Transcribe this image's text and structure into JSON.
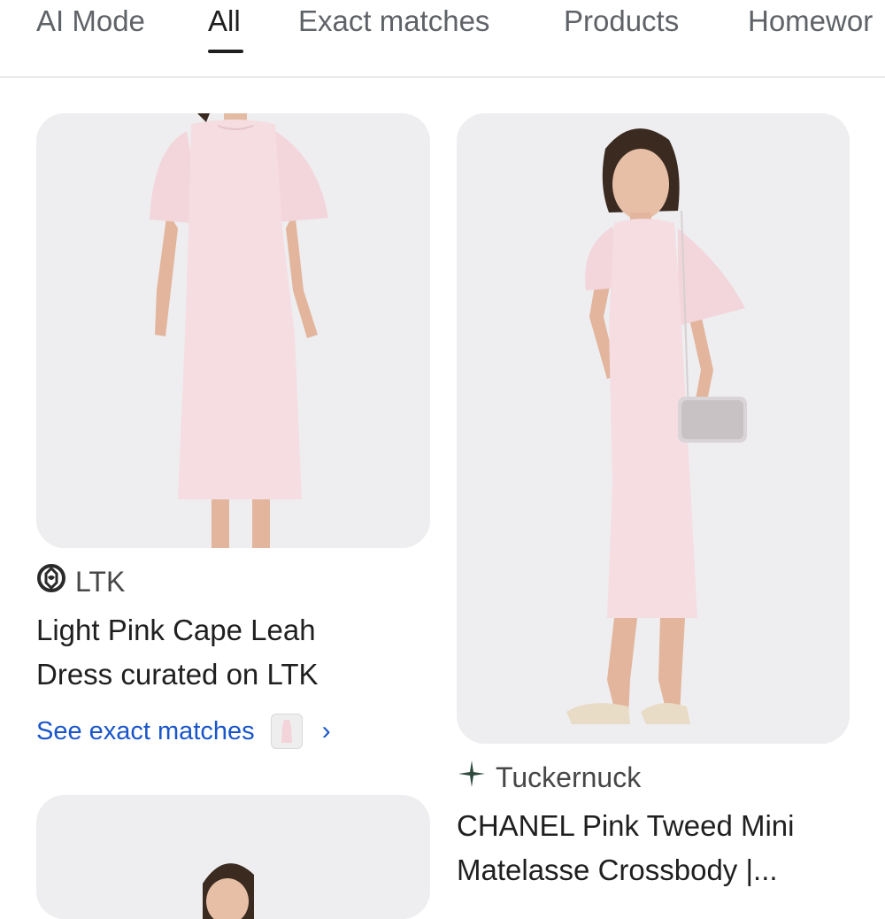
{
  "tabs": [
    {
      "label": "AI Mode",
      "active": false
    },
    {
      "label": "All",
      "active": true
    },
    {
      "label": "Exact matches",
      "active": false
    },
    {
      "label": "Products",
      "active": false
    },
    {
      "label": "Homewor",
      "active": false
    }
  ],
  "results": [
    {
      "source": "LTK",
      "source_icon": "ltk-logo-icon",
      "title_line1": "Light Pink Cape Leah",
      "title_line2": "Dress curated on LTK",
      "exact_matches_label": "See exact matches"
    },
    {
      "source": "Tuckernuck",
      "source_icon": "sparkle-logo-icon",
      "title_line1": "CHANEL Pink Tweed Mini",
      "title_line2": "Matelasse Crossbody |..."
    }
  ],
  "colors": {
    "link": "#1a56c9",
    "dress": "#f5dde2",
    "thumb_bg": "#ececee"
  }
}
